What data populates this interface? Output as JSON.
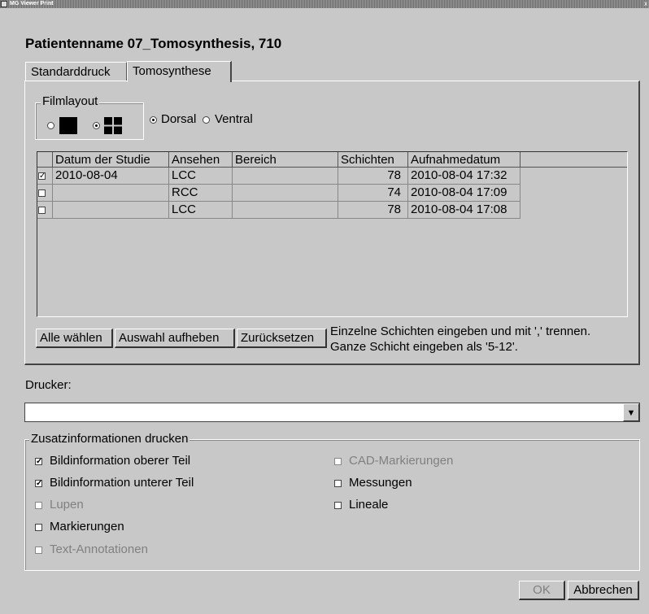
{
  "window": {
    "title": "MG Viewer Print",
    "close_glyph": "x"
  },
  "patient_title": "Patientenname 07_Tomosynthesis, 710",
  "tabs": [
    {
      "label": "Standarddruck",
      "active": false
    },
    {
      "label": "Tomosynthese",
      "active": true
    }
  ],
  "filmlayout": {
    "legend": "Filmlayout",
    "options": [
      {
        "icon": "single-frame-icon",
        "selected": false
      },
      {
        "icon": "quad-frame-icon",
        "selected": true
      }
    ]
  },
  "orientation": {
    "dorsal_label": "Dorsal",
    "ventral_label": "Ventral",
    "selected": "Dorsal"
  },
  "table": {
    "columns": [
      "Datum der Studie",
      "Ansehen",
      "Bereich",
      "Schichten",
      "Aufnahmedatum"
    ],
    "rows": [
      {
        "checked": true,
        "date": "2010-08-04",
        "view": "LCC",
        "range": "",
        "slices": "78",
        "acquired": "2010-08-04 17:32"
      },
      {
        "checked": false,
        "date": "",
        "view": "RCC",
        "range": "",
        "slices": "74",
        "acquired": "2010-08-04 17:09"
      },
      {
        "checked": false,
        "date": "",
        "view": "LCC",
        "range": "",
        "slices": "78",
        "acquired": "2010-08-04 17:08"
      }
    ]
  },
  "buttons": {
    "select_all": "Alle wählen",
    "deselect": "Auswahl aufheben",
    "reset": "Zurücksetzen",
    "ok": "OK",
    "cancel": "Abbrechen"
  },
  "hint": {
    "line1": "Einzelne Schichten eingeben und mit ',' trennen.",
    "line2": "Ganze Schicht eingeben als '5-12'."
  },
  "printer": {
    "label": "Drucker:",
    "value": ""
  },
  "extra_info": {
    "legend": "Zusatzinformationen drucken",
    "left": [
      {
        "label": "Bildinformation oberer Teil",
        "checked": true,
        "enabled": true
      },
      {
        "label": "Bildinformation unterer Teil",
        "checked": true,
        "enabled": true
      },
      {
        "label": "Lupen",
        "checked": false,
        "enabled": false
      },
      {
        "label": "Markierungen",
        "checked": false,
        "enabled": true
      },
      {
        "label": "Text-Annotationen",
        "checked": false,
        "enabled": false
      }
    ],
    "right": [
      {
        "label": "CAD-Markierungen",
        "checked": false,
        "enabled": false
      },
      {
        "label": "Messungen",
        "checked": false,
        "enabled": true
      },
      {
        "label": "Lineale",
        "checked": false,
        "enabled": true
      }
    ]
  },
  "check_glyph": "✓"
}
